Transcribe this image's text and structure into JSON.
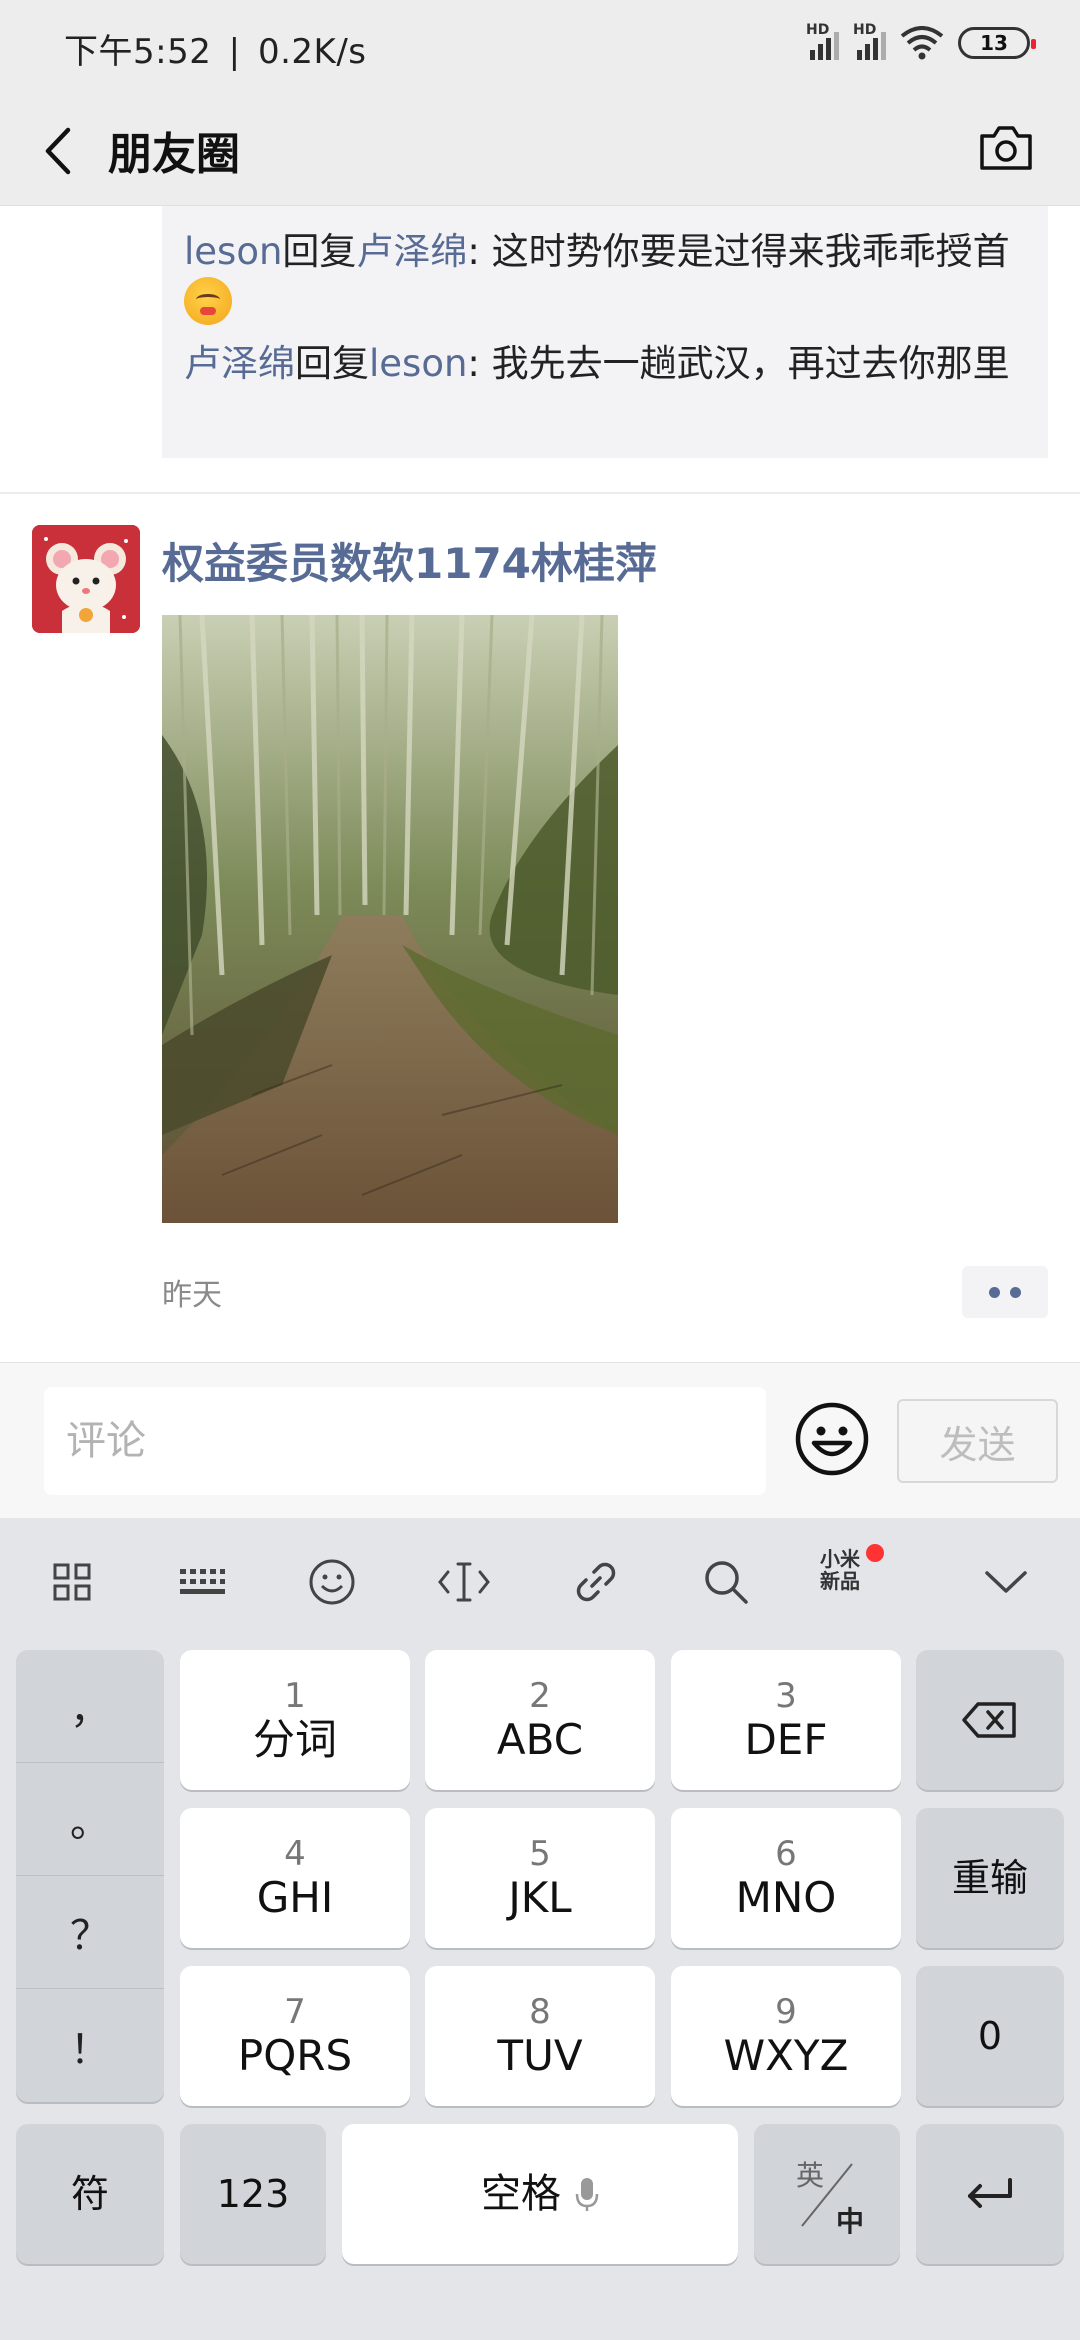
{
  "status_bar": {
    "time": "下午5:52",
    "separator": "|",
    "speed": "0.2K/s",
    "signal1_label": "HD",
    "signal2_label": "HD",
    "battery": "13"
  },
  "nav": {
    "title": "朋友圈",
    "back_icon": "chevron-left-icon",
    "camera_icon": "camera-icon"
  },
  "comments": [
    {
      "from": "leson",
      "verb": "回复",
      "to": "卢泽绵",
      "text": ": 这时势你要是过得来我乖乖授首",
      "emoji": "face-emoji"
    },
    {
      "from": "卢泽绵",
      "verb": "回复",
      "to": "leson",
      "text": ": 我先去一趟武汉，再过去你那里"
    }
  ],
  "post": {
    "author": "权益委员数软1174林桂萍",
    "time": "昨天",
    "image": "bamboo-forest-path-photo"
  },
  "comment_bar": {
    "placeholder": "评论",
    "send": "发送"
  },
  "keyboard": {
    "toolbar_icons": [
      "grid-icon",
      "keyboard-icon",
      "smiley-icon",
      "cursor-icon",
      "link-icon",
      "search-icon",
      "xiaomi-new-icon",
      "collapse-icon"
    ],
    "xiaomi_line1": "小米",
    "xiaomi_line2": "新品",
    "punctuation": [
      "，",
      "。",
      "？",
      "！"
    ],
    "keys": [
      {
        "num": "1",
        "label": "分词"
      },
      {
        "num": "2",
        "label": "ABC"
      },
      {
        "num": "3",
        "label": "DEF"
      },
      {
        "num": "4",
        "label": "GHI"
      },
      {
        "num": "5",
        "label": "JKL"
      },
      {
        "num": "6",
        "label": "MNO"
      },
      {
        "num": "7",
        "label": "PQRS"
      },
      {
        "num": "8",
        "label": "TUV"
      },
      {
        "num": "9",
        "label": "WXYZ"
      }
    ],
    "retype": "重输",
    "zero": "0",
    "symbols": "符",
    "numbers": "123",
    "space": "空格",
    "lang_top": "英",
    "lang_bottom": "中"
  }
}
